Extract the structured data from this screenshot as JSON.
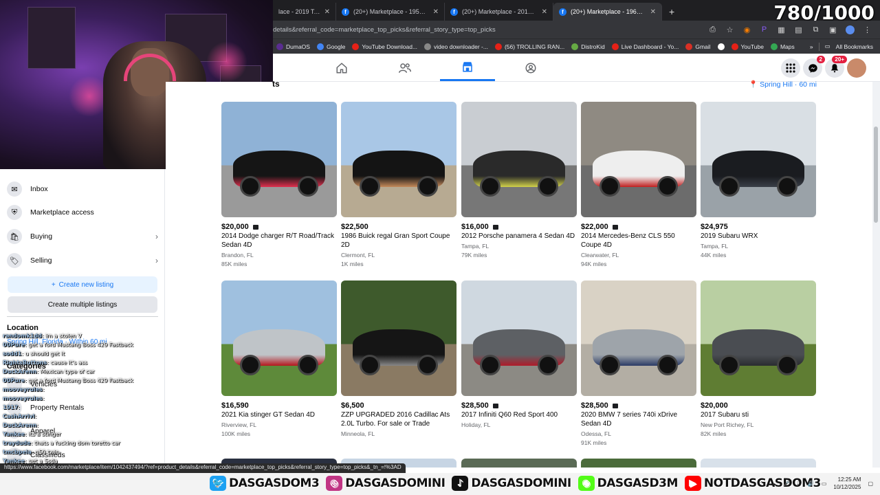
{
  "counter": "780/1000",
  "browser": {
    "tabs": [
      {
        "title": "lace - 2019 Toyo",
        "active": false,
        "has_icon": false
      },
      {
        "title": "(20+) Marketplace - 1953 Huds",
        "active": false,
        "has_icon": true
      },
      {
        "title": "(20+) Marketplace - 2019 Suba",
        "active": false,
        "has_icon": true
      },
      {
        "title": "(20+) Marketplace - 1965 Buick",
        "active": true,
        "has_icon": true
      }
    ],
    "close_glyph": "✕",
    "new_tab": "+",
    "url": "details&referral_code=marketplace_top_picks&referral_story_type=top_picks",
    "bookmarks": [
      {
        "label": "DumaOS",
        "color": "#5a2d91"
      },
      {
        "label": "Google",
        "color": "#4285f4"
      },
      {
        "label": "YouTube Download...",
        "color": "#e62117"
      },
      {
        "label": "video downloader -...",
        "color": "#888888"
      },
      {
        "label": "(56) TROLLING RAN...",
        "color": "#e62117"
      },
      {
        "label": "DistroKid",
        "color": "#6a4"
      },
      {
        "label": "Live Dashboard - Yo...",
        "color": "#e62117"
      },
      {
        "label": "Gmail",
        "color": "#d93025"
      },
      {
        "label": "",
        "color": "#ffffff"
      },
      {
        "label": "YouTube",
        "color": "#e62117"
      },
      {
        "label": "Maps",
        "color": "#34a853"
      }
    ],
    "bookmarks_more": "»",
    "all_bookmarks": "All Bookmarks"
  },
  "header": {
    "messenger_badge": "2",
    "notifications_badge": "20+"
  },
  "sidebar": {
    "items": [
      {
        "label": "Inbox",
        "icon": "inbox-icon",
        "glyph": "✉",
        "chevron": false
      },
      {
        "label": "Marketplace access",
        "icon": "shield-icon",
        "glyph": "⛨",
        "chevron": false
      },
      {
        "label": "Buying",
        "icon": "shopping-bag-icon",
        "glyph": "🛍",
        "chevron": true
      },
      {
        "label": "Selling",
        "icon": "tag-icon",
        "glyph": "🏷",
        "chevron": true
      }
    ],
    "chevron": "›",
    "create_listing": "Create new listing",
    "create_multiple": "Create multiple listings",
    "location_heading": "Location",
    "location_value": "Spring Hill, Florida · Within 60 mi",
    "categories_heading": "Categories",
    "categories": [
      "Vehicles",
      "Property Rentals",
      "Apparel",
      "Classifieds"
    ]
  },
  "chat": [
    {
      "user": "randomk1dd",
      "msg": ": im a stolen V"
    },
    {
      "user": "00Pure",
      "msg": ": get a ford Mustang Boss 429 Fastback"
    },
    {
      "user": "sodd1",
      "msg": ": u should get it"
    },
    {
      "user": "RightsButtons",
      "msg": ": cause it's ass"
    },
    {
      "user": "DuckArenn",
      "msg": ": Mexican type of car"
    },
    {
      "user": "00Pure",
      "msg": ": get a ford Mustang Boss 429 Fastback"
    },
    {
      "user": "mooveyrules",
      "msg": ":"
    },
    {
      "user": "mooveyrules",
      "msg": ":"
    },
    {
      "user": "1917",
      "msg": ":"
    },
    {
      "user": "CashArrivl",
      "msg": ":"
    },
    {
      "user": "DuckArenn",
      "msg": ":"
    },
    {
      "user": "Yankee",
      "msg": ": its a stinger"
    },
    {
      "user": "traydude",
      "msg": ": thats a fucking dom toretto car"
    },
    {
      "user": "tmcbpeia",
      "msg": ": q50 twin"
    },
    {
      "user": "Yankee",
      "msg": ": get a Ssda"
    }
  ],
  "status_url": "https://www.facebook.com/marketplace/item/1042437494/?ref=product_details&referral_code=marketplace_top_picks&referral_story_type=top_picks&_tn_=!%3AD",
  "location_pill": "Spring Hill · 60 mi",
  "listings": [
    {
      "price": "$20,000",
      "video": true,
      "title": "2014 Dodge charger R/T Road/Track Sedan 4D",
      "place": "Brandon, FL",
      "miles": "85K miles",
      "sky": "#8fb2d6",
      "ground": "#9a9a9a",
      "car": "#151515",
      "accent": "#e0304f"
    },
    {
      "price": "$22,500",
      "video": false,
      "title": "1986 Buick regal Gran Sport Coupe 2D",
      "place": "Clermont, FL",
      "miles": "1K miles",
      "sky": "#a9c7e6",
      "ground": "#b7aa92",
      "car": "#141414",
      "accent": "#c58a5a"
    },
    {
      "price": "$16,000",
      "video": true,
      "title": "2012 Porsche panamera 4 Sedan 4D",
      "place": "Tampa, FL",
      "miles": "79K miles",
      "sky": "#c9cdd2",
      "ground": "#777777",
      "car": "#2a2a2a",
      "accent": "#d2d24a"
    },
    {
      "price": "$22,000",
      "video": true,
      "title": "2014 Mercedes-Benz CLS 550 Coupe 4D",
      "place": "Clearwater, FL",
      "miles": "94K miles",
      "sky": "#8f8a82",
      "ground": "#6c6c6c",
      "car": "#eeeeee",
      "accent": "#c02020"
    },
    {
      "price": "$24,975",
      "video": false,
      "title": "2019 Subaru WRX",
      "place": "Tampa, FL",
      "miles": "44K miles",
      "sky": "#d9dfe4",
      "ground": "#9aa2a8",
      "car": "#1a1c20",
      "accent": "#3a3f48"
    },
    {
      "price": "$16,590",
      "video": false,
      "title": "2021 Kia stinger GT Sedan 4D",
      "place": "Riverview, FL",
      "miles": "100K miles",
      "sky": "#9fc0df",
      "ground": "#5e8a3a",
      "car": "#bfc4c8",
      "accent": "#b5161d"
    },
    {
      "price": "$6,500",
      "video": false,
      "title": "ZZP UPGRADED 2016 Cadillac Ats 2.0L Turbo. For sale or Trade",
      "place": "Minneola, FL",
      "miles": "",
      "sky": "#3e5a2c",
      "ground": "#8a7a63",
      "car": "#151515",
      "accent": "#888888"
    },
    {
      "price": "$28,500",
      "video": true,
      "title": "2017 Infiniti Q60 Red Sport 400",
      "place": "Holiday, FL",
      "miles": "",
      "sky": "#cfd8e0",
      "ground": "#8c8a84",
      "car": "#5d6064",
      "accent": "#b01b2a"
    },
    {
      "price": "$28,500",
      "video": true,
      "title": "2020 BMW 7 series 740i xDrive Sedan 4D",
      "place": "Odessa, FL",
      "miles": "91K miles",
      "sky": "#d9d2c5",
      "ground": "#b3aea4",
      "car": "#9ea4aa",
      "accent": "#2b3b66"
    },
    {
      "price": "$20,000",
      "video": false,
      "title": "2017 Subaru sti",
      "place": "New Port Richey, FL",
      "miles": "82K miles",
      "sky": "#b9cfa2",
      "ground": "#5f7d33",
      "car": "#4a4d52",
      "accent": "#2a2c30"
    }
  ],
  "social": [
    {
      "handle": "DASGASDOM3",
      "icon": "twitter-icon",
      "color": "#1da1f2",
      "glyph": "🐦"
    },
    {
      "handle": "DASGASDOMINI",
      "icon": "instagram-icon",
      "color": "#c13584",
      "glyph": "◎"
    },
    {
      "handle": "DASGASDOMINI",
      "icon": "tiktok-icon",
      "color": "#111111",
      "glyph": "♪"
    },
    {
      "handle": "DASGASD3M",
      "icon": "kick-icon",
      "color": "#53fc18",
      "glyph": "◉"
    },
    {
      "handle": "NOTDASGASDOM3",
      "icon": "youtube-icon",
      "color": "#ff0000",
      "glyph": "▶"
    }
  ],
  "clock": {
    "time": "12:25 AM",
    "date": "10/12/2025"
  }
}
